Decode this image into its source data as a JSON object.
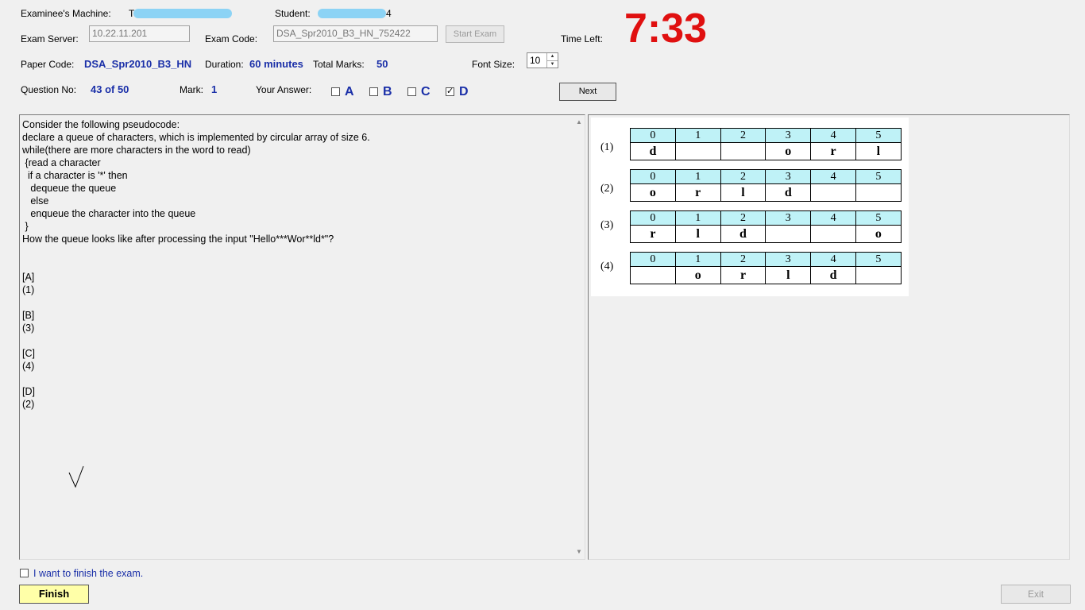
{
  "header": {
    "machine_label": "Examinee's Machine:",
    "machine_value_prefix": "T",
    "student_label": "Student:",
    "student_value_suffix": "4",
    "server_label": "Exam Server:",
    "server_value": "10.22.11.201",
    "exam_code_label": "Exam Code:",
    "exam_code_value": "DSA_Spr2010_B3_HN_752422",
    "start_exam_label": "Start Exam",
    "time_left_label": "Time Left:",
    "time_left_value": "7:33",
    "paper_code_label": "Paper Code:",
    "paper_code_value": "DSA_Spr2010_B3_HN",
    "duration_label": "Duration:",
    "duration_value": "60 minutes",
    "total_marks_label": "Total Marks:",
    "total_marks_value": "50",
    "font_size_label": "Font Size:",
    "font_size_value": "10"
  },
  "question_bar": {
    "question_no_label": "Question No:",
    "question_no_value": "43 of 50",
    "mark_label": "Mark:",
    "mark_value": "1",
    "your_answer_label": "Your Answer:",
    "answers": [
      {
        "letter": "A",
        "checked": false
      },
      {
        "letter": "B",
        "checked": false
      },
      {
        "letter": "C",
        "checked": false
      },
      {
        "letter": "D",
        "checked": true
      }
    ],
    "next_label": "Next"
  },
  "question": {
    "text": "Consider the following pseudocode:\ndeclare a queue of characters, which is implemented by circular array of size 6.\nwhile(there are more characters in the word to read)\n {read a character\n  if a character is '*' then\n   dequeue the queue\n   else\n   enqueue the character into the queue\n }\nHow the queue looks like after processing the input \"Hello***Wor**ld*\"?\n\n\n[A]\n(1)\n\n[B]\n(3)\n\n[C]\n(4)\n\n[D]\n(2)"
  },
  "options_image": {
    "options": [
      {
        "label": "(1)",
        "headers": [
          "0",
          "1",
          "2",
          "3",
          "4",
          "5"
        ],
        "cells": [
          "d",
          "",
          "",
          "o",
          "r",
          "l"
        ]
      },
      {
        "label": "(2)",
        "headers": [
          "0",
          "1",
          "2",
          "3",
          "4",
          "5"
        ],
        "cells": [
          "o",
          "r",
          "l",
          "d",
          "",
          ""
        ]
      },
      {
        "label": "(3)",
        "headers": [
          "0",
          "1",
          "2",
          "3",
          "4",
          "5"
        ],
        "cells": [
          "r",
          "l",
          "d",
          "",
          "",
          "o"
        ]
      },
      {
        "label": "(4)",
        "headers": [
          "0",
          "1",
          "2",
          "3",
          "4",
          "5"
        ],
        "cells": [
          "",
          "o",
          "r",
          "l",
          "d",
          ""
        ]
      }
    ]
  },
  "footer": {
    "finish_checkbox_label": "I want to finish the exam.",
    "finish_label": "Finish",
    "exit_label": "Exit"
  },
  "colors": {
    "accent_blue": "#1a2fa8",
    "timer_red": "#e01010",
    "finish_yellow": "#ffffa8",
    "table_header_cyan": "#bff2f7"
  }
}
